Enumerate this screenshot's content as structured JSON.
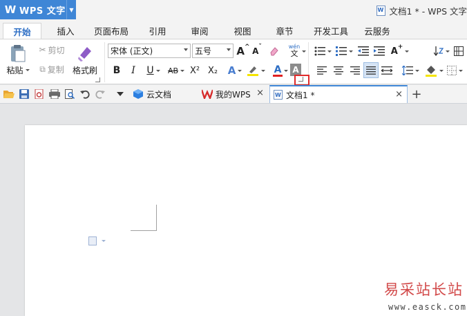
{
  "app": {
    "logo": "W",
    "name": "WPS 文字",
    "drop_icon": "chevron-down-icon"
  },
  "window": {
    "title": "文档1 * - WPS 文字"
  },
  "ribbon_tabs": [
    "开始",
    "插入",
    "页面布局",
    "引用",
    "审阅",
    "视图",
    "章节",
    "开发工具",
    "云服务"
  ],
  "active_tab": "开始",
  "clipboard": {
    "paste_label": "粘贴",
    "cut_label": "剪切",
    "copy_label": "复制",
    "format_painter_label": "格式刷"
  },
  "font": {
    "font_name": "宋体 (正文)",
    "font_size": "五号",
    "bold": "B",
    "italic": "I",
    "underline": "U",
    "strikethrough": "AB",
    "superscript": "X²",
    "subscript": "X₂",
    "phonetic_top": "wén",
    "phonetic_bottom": "文",
    "grow": "A",
    "shrink": "A",
    "effects": "A",
    "font_color": "A",
    "char_shading": "A"
  },
  "colors": {
    "accent": "#3f86d6",
    "highlight_box": "#e02a2a",
    "font_color_bar": "#e02020",
    "highlighter_bar": "#f5e400",
    "shading_bar": "#888888",
    "fill_bar": "#f5e400"
  },
  "doc_tabs": [
    {
      "label": "云文档",
      "icon": "cloud-cube-icon"
    },
    {
      "label": "我的WPS",
      "icon": "wps-logo-icon"
    },
    {
      "label": "文档1 *",
      "icon": "document-icon"
    }
  ],
  "doc_tab_close": "×",
  "new_tab": "+",
  "watermark": {
    "text": "易采站长站",
    "url": "www.easck.com"
  }
}
